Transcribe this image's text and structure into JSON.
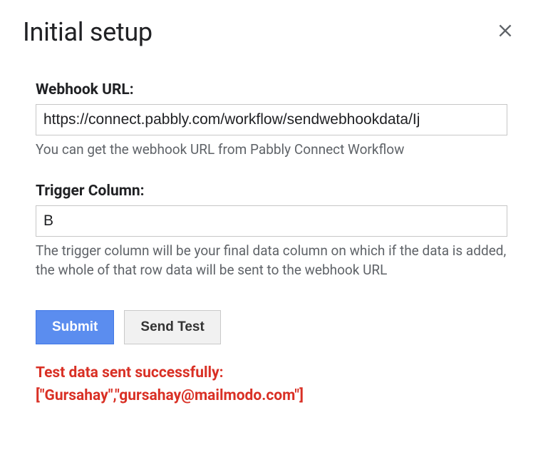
{
  "dialog": {
    "title": "Initial setup"
  },
  "fields": {
    "webhook": {
      "label": "Webhook URL:",
      "value": "https://connect.pabbly.com/workflow/sendwebhookdata/Ij",
      "help": "You can get the webhook URL from Pabbly Connect Workflow"
    },
    "trigger": {
      "label": "Trigger Column:",
      "value": "B",
      "help": "The trigger column will be your final data column on which if the data is added, the whole of that row data will be sent to the webhook URL"
    }
  },
  "buttons": {
    "submit": "Submit",
    "sendTest": "Send Test"
  },
  "status": {
    "line1": "Test data sent successfully:",
    "line2": "[\"Gursahay\",\"gursahay@mailmodo.com\"]"
  }
}
